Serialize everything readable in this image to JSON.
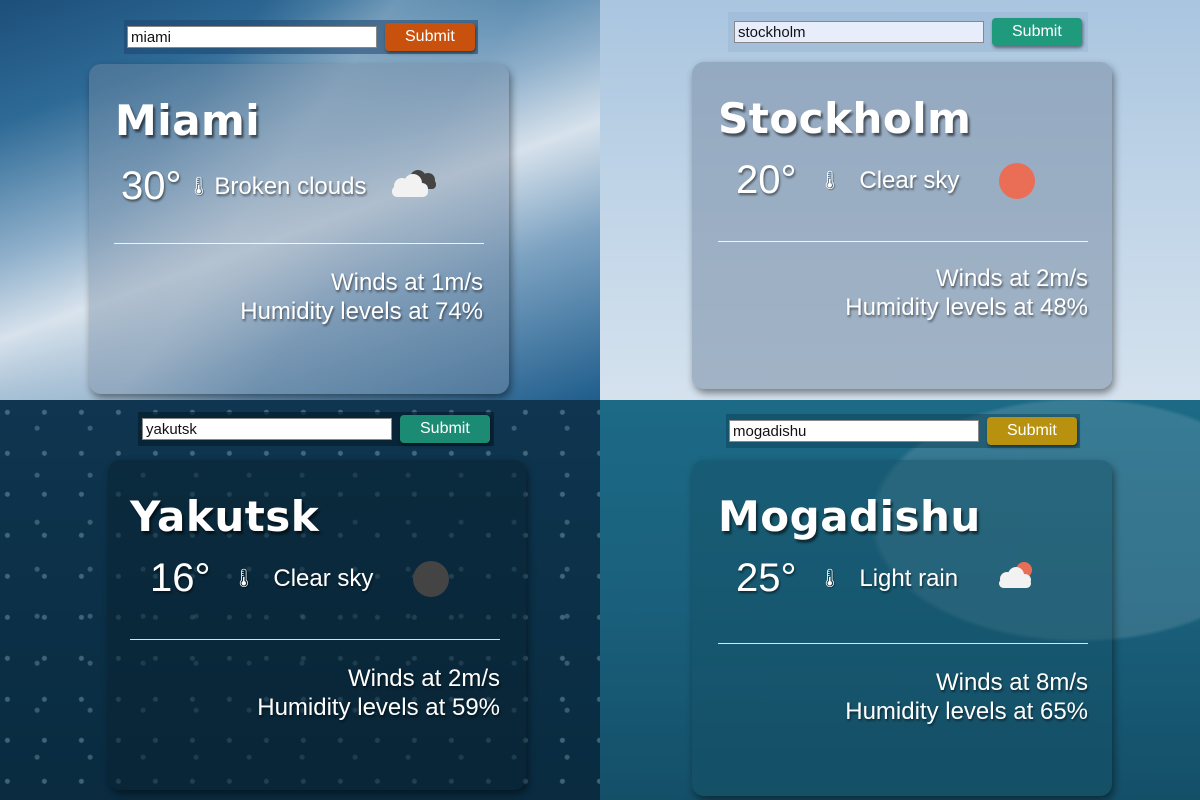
{
  "panels": [
    {
      "search_value": "miami",
      "submit_label": "Submit",
      "city": "Miami",
      "temperature": "30°",
      "description": "Broken clouds",
      "icon": "broken-clouds-icon",
      "winds": "Winds at 1m/s",
      "humidity": "Humidity levels at 74%",
      "accent_color": "#c8510d"
    },
    {
      "search_value": "stockholm",
      "submit_label": "Submit",
      "city": "Stockholm",
      "temperature": "20°",
      "description": "Clear sky",
      "icon": "clear-sky-day-icon",
      "winds": "Winds at 2m/s",
      "humidity": "Humidity levels at 48%",
      "accent_color": "#1f9a7c"
    },
    {
      "search_value": "yakutsk",
      "submit_label": "Submit",
      "city": "Yakutsk",
      "temperature": "16°",
      "description": "Clear sky",
      "icon": "clear-sky-night-icon",
      "winds": "Winds at 2m/s",
      "humidity": "Humidity levels at 59%",
      "accent_color": "#1b8c73"
    },
    {
      "search_value": "mogadishu",
      "submit_label": "Submit",
      "city": "Mogadishu",
      "temperature": "25°",
      "description": "Light rain",
      "icon": "light-rain-icon",
      "winds": "Winds at 8m/s",
      "humidity": "Humidity levels at 65%",
      "accent_color": "#b8920f"
    }
  ],
  "thermometer_glyph": "🌡"
}
